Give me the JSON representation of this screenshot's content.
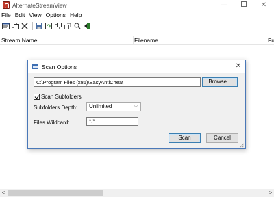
{
  "window": {
    "title": "AlternateStreamView",
    "minimize_glyph": "—",
    "close_glyph": "✕"
  },
  "menu": [
    "File",
    "Edit",
    "View",
    "Options",
    "Help"
  ],
  "toolbar": {
    "icons": [
      "properties-icon",
      "copy-icon",
      "delete-icon",
      "save-icon",
      "refresh-icon",
      "extract-icon",
      "html-report-icon",
      "find-icon",
      "exit-icon"
    ]
  },
  "list": {
    "columns": [
      "Stream Name",
      "Filename",
      "Fu"
    ]
  },
  "scrollbar": {
    "left_arrow": "<",
    "right_arrow": ">"
  },
  "dialog": {
    "title": "Scan Options",
    "close_glyph": "✕",
    "folder_path": "C:\\Program Files (x86)\\EasyAntiCheat",
    "browse_label": "Browse...",
    "scan_subfolders_label": "Scan Subfolders",
    "scan_subfolders_checked": true,
    "depth_label": "Subfolders Depth:",
    "depth_value": "Unlimited",
    "depth_chevron": "⌵",
    "wildcard_label": "Files Wildcard:",
    "wildcard_value": "*.*",
    "scan_label": "Scan",
    "cancel_label": "Cancel"
  },
  "colors": {
    "dialog_border": "#4a78b8",
    "dialog_bg": "#f0f0f0",
    "focus_border": "#3c7fb1"
  }
}
